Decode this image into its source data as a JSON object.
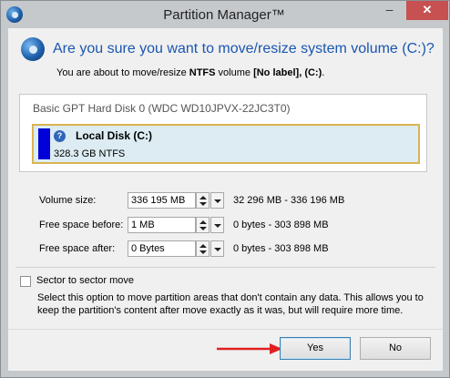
{
  "window": {
    "title": "Partition Manager™",
    "minimize_symbol": "–",
    "close_symbol": "✕"
  },
  "header": {
    "title": "Are you sure you want to move/resize system volume (C:)?",
    "subtitle_prefix": "You are about to move/resize ",
    "subtitle_fs": "NTFS",
    "subtitle_mid": " volume ",
    "subtitle_label": "[No label]",
    "subtitle_sep": ", ",
    "subtitle_drive": "(C:)",
    "subtitle_end": "."
  },
  "disk": {
    "title": "Basic GPT Hard Disk 0 (WDC WD10JPVX-22JC3T0)",
    "partition_name": "Local Disk (C:)",
    "partition_info": "328.3 GB NTFS",
    "help_symbol": "?",
    "bar_color": "#0000d8",
    "border_color": "#d9b454"
  },
  "fields": {
    "volume_size": {
      "label": "Volume size:",
      "value": "336 195",
      "unit": "MB",
      "range": "32 296 MB - 336 196 MB"
    },
    "free_before": {
      "label": "Free space before:",
      "value": "1 MB",
      "range": "0 bytes - 303 898 MB"
    },
    "free_after": {
      "label": "Free space after:",
      "value": "0 Bytes",
      "range": "0 bytes - 303 898 MB"
    }
  },
  "sector": {
    "label": "Sector to sector move",
    "description": "Select this option to move partition areas that don't contain any data. This allows you to keep the partition's content after move exactly as it was, but will require more time.",
    "checked": false
  },
  "buttons": {
    "yes": "Yes",
    "no": "No"
  },
  "icons": {
    "app": "partition-manager-icon",
    "spinner": "spinner-icon",
    "dropdown": "chevron-down-icon",
    "pointer_arrow": "red-arrow-icon"
  },
  "colors": {
    "title_blue": "#1a56b0",
    "close_red": "#c75050",
    "arrow_red": "#e02020"
  }
}
